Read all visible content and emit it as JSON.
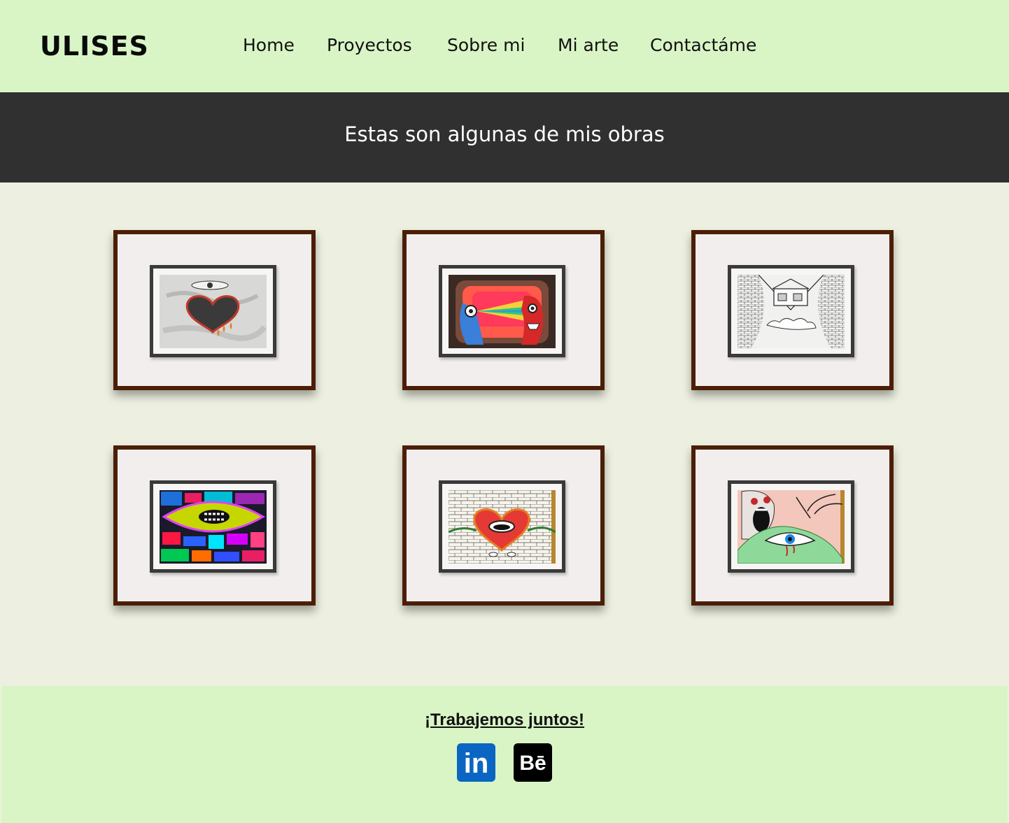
{
  "header": {
    "logo": "ULISES",
    "nav": [
      "Home",
      "Proyectos",
      "Sobre mi",
      "Mi arte",
      "Contactáme"
    ]
  },
  "banner": {
    "title": "Estas son algunas de mis obras"
  },
  "gallery": {
    "artworks": [
      "eye-and-heart-drawing",
      "faces-rainbow-drawing",
      "house-brick-walls-drawing",
      "colorful-eye-mosaic-drawing",
      "heart-mouth-brick-wall-drawing",
      "screaming-face-eye-drawing"
    ]
  },
  "footer": {
    "cta": "¡Trabajemos juntos!",
    "linkedin_label": "in",
    "behance_label": "Bē",
    "linkedin_color": "#0a66c2",
    "behance_color": "#000000"
  },
  "colors": {
    "header_bg": "#d9f5c6",
    "banner_bg": "#303030",
    "page_bg": "#edf0e0",
    "frame_wood": "#4b1e05"
  }
}
